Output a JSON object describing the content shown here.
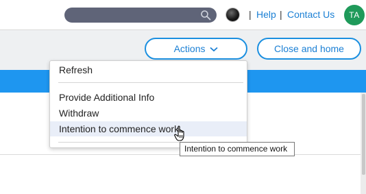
{
  "header": {
    "search_placeholder": "",
    "help_label": "Help",
    "contact_label": "Contact Us",
    "separator": "|",
    "avatar_initials": "TA",
    "avatar_color": "#1f9a5a"
  },
  "toolbar": {
    "actions_label": "Actions",
    "close_home_label": "Close and home",
    "accent_color": "#1a8fe0"
  },
  "actions_menu": {
    "items": [
      {
        "label": "Refresh"
      },
      {
        "label": "Provide Additional Info"
      },
      {
        "label": "Withdraw"
      },
      {
        "label": "Intention to commence work",
        "hovered": true
      }
    ]
  },
  "tooltip": {
    "text": "Intention to commence work"
  },
  "icons": {
    "search": "search-icon",
    "chevron": "chevron-down-icon",
    "theme": "theme-toggle-icon",
    "cursor": "hand-pointer-icon"
  }
}
